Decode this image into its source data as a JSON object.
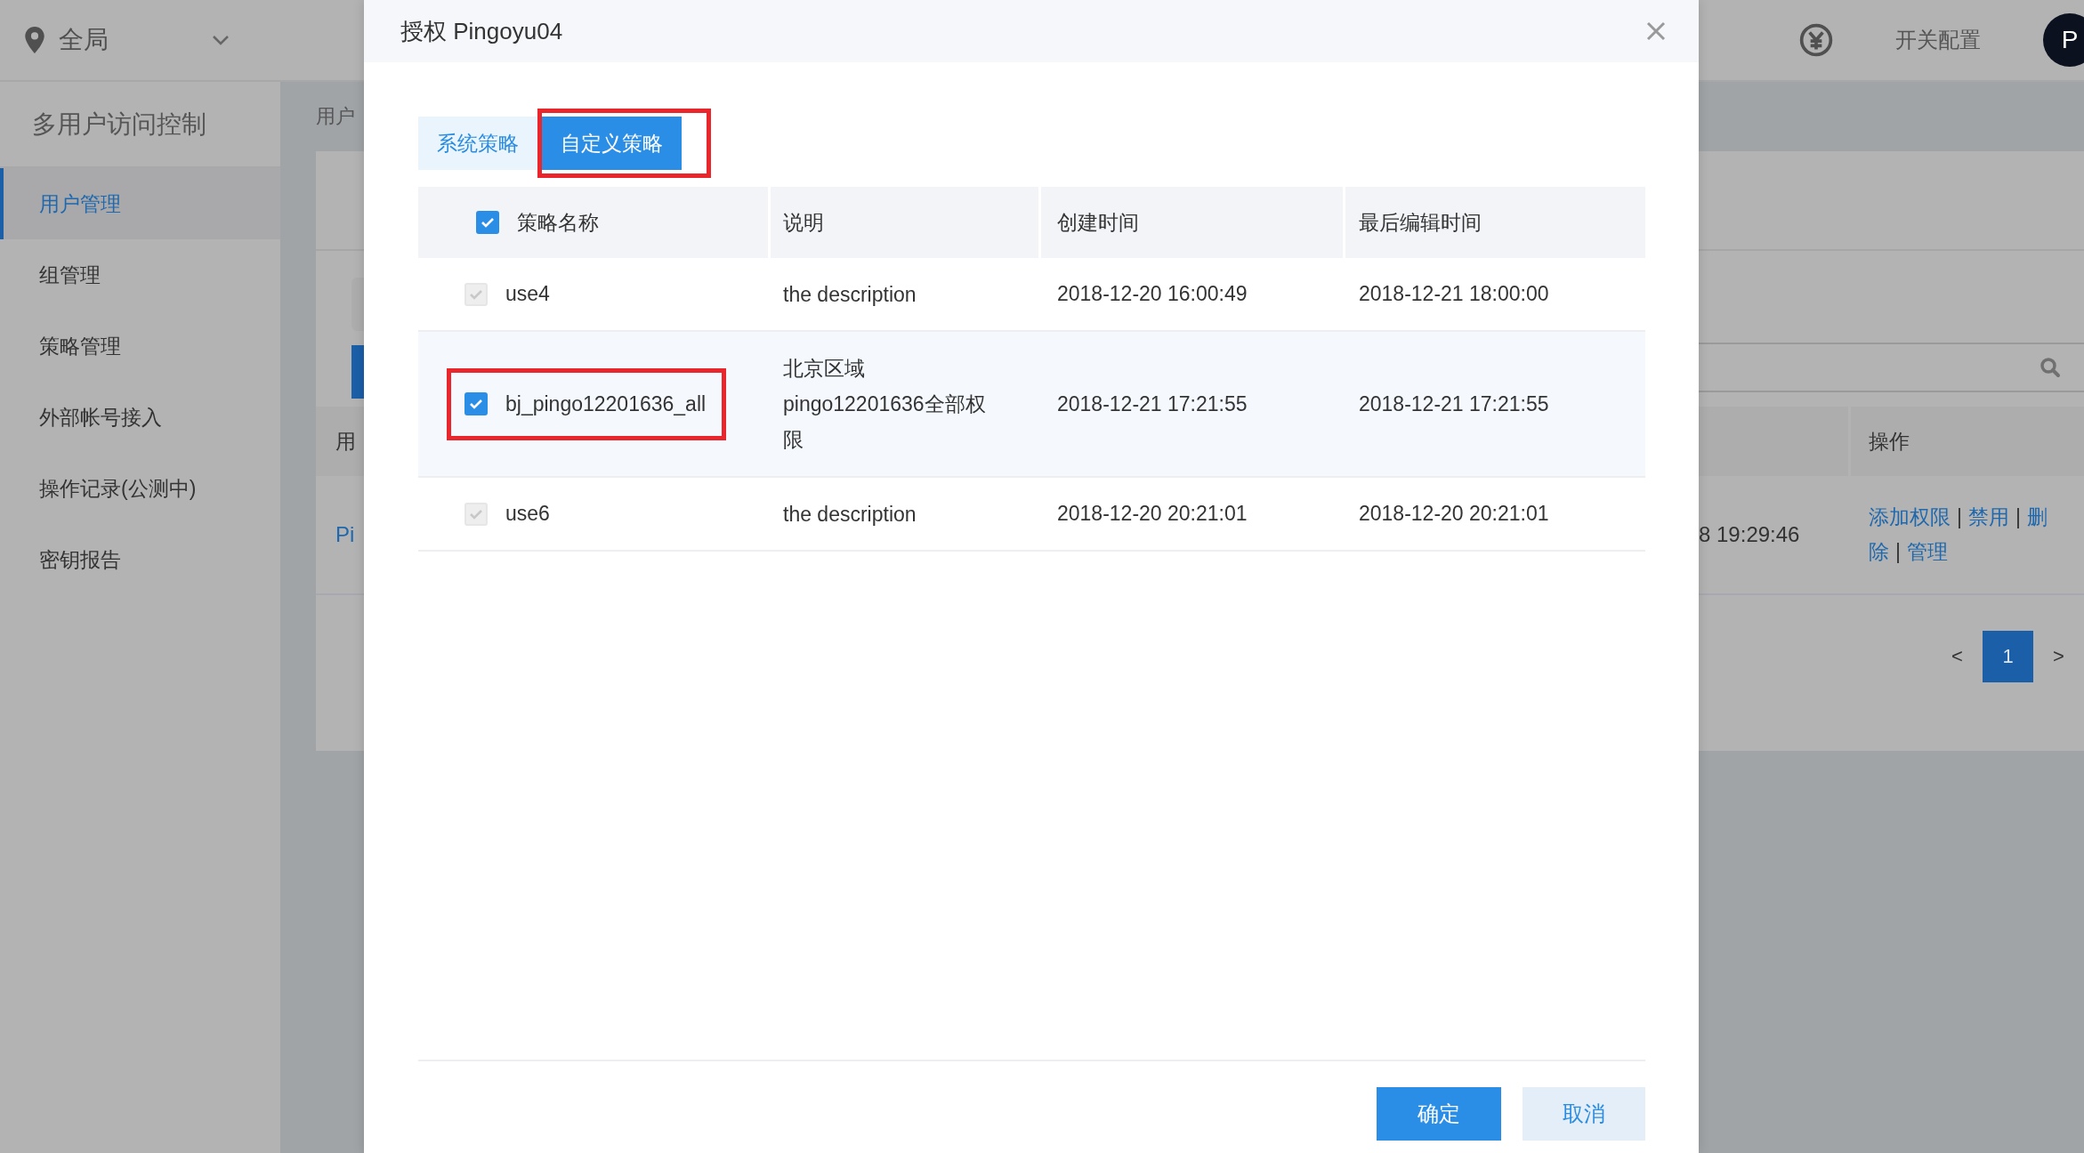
{
  "region_selector": {
    "label": "全局"
  },
  "top_bar": {
    "links": [
      {
        "label": "开关配置"
      }
    ],
    "avatar": "P"
  },
  "sidebar": {
    "title": "多用户访问控制",
    "items": [
      {
        "label": "用户管理",
        "selected": true
      },
      {
        "label": "组管理",
        "selected": false
      },
      {
        "label": "策略管理",
        "selected": false
      },
      {
        "label": "外部帐号接入",
        "selected": false
      },
      {
        "label": "操作记录(公测中)",
        "selected": false
      },
      {
        "label": "密钥报告",
        "selected": false
      }
    ]
  },
  "background_page": {
    "breadcrumb": "用户",
    "table": {
      "columns": [
        "用",
        "操作"
      ],
      "rows": [
        {
          "name": "Pi",
          "time": "8 19:29:46",
          "actions": [
            "添加权限",
            "禁用",
            "删除",
            "管理"
          ],
          "separator": "|"
        }
      ]
    },
    "pagination": {
      "prev": "<",
      "pages": [
        {
          "label": "1",
          "selected": true
        }
      ],
      "next": ">"
    }
  },
  "dialog": {
    "title": "授权 Pingoyu04",
    "tabs": [
      {
        "label": "系统策略",
        "selected": false,
        "highlighted": false
      },
      {
        "label": "自定义策略",
        "selected": true,
        "highlighted": true
      }
    ],
    "table": {
      "header_checked": true,
      "columns": [
        "策略名称",
        "说明",
        "创建时间",
        "最后编辑时间"
      ],
      "rows": [
        {
          "name": "use4",
          "description": "the description",
          "created": "2018-12-20 16:00:49",
          "edited": "2018-12-21 18:00:00",
          "checked": true,
          "disabled": true,
          "active": false,
          "highlighted": false
        },
        {
          "name": "bj_pingo12201636_all",
          "description": "北京区域 pingo12201636全部权限",
          "created": "2018-12-21 17:21:55",
          "edited": "2018-12-21 17:21:55",
          "checked": true,
          "disabled": false,
          "active": true,
          "highlighted": true
        },
        {
          "name": "use6",
          "description": "the description",
          "created": "2018-12-20 20:21:01",
          "edited": "2018-12-20 20:21:01",
          "checked": true,
          "disabled": true,
          "active": false,
          "highlighted": false
        }
      ]
    },
    "buttons": [
      {
        "label": "确定",
        "kind": "primary"
      },
      {
        "label": "取消",
        "kind": "secondary"
      }
    ]
  }
}
